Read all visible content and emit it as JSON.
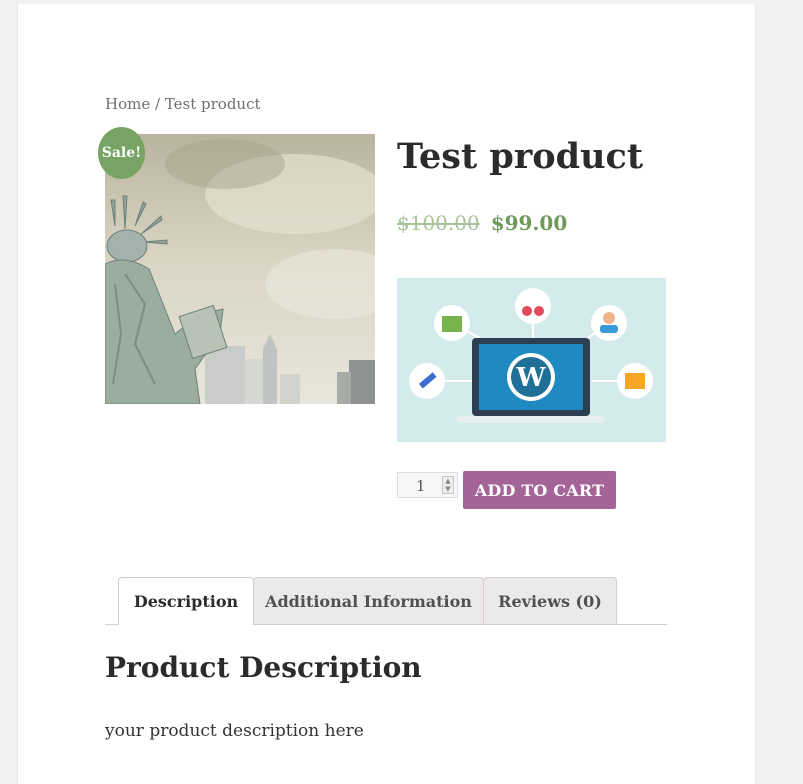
{
  "breadcrumb": {
    "home": "Home",
    "separator": " / ",
    "current": "Test product"
  },
  "product": {
    "sale_badge": "Sale!",
    "title": "Test product",
    "price_old": "$100.00",
    "price_new": "$99.00",
    "quantity": "1",
    "add_to_cart_label": "ADD TO CART",
    "main_image_icon": "statue-of-liberty-photo",
    "promo_image_icon": "wordpress-laptop-illustration"
  },
  "tabs": [
    {
      "label": "Description"
    },
    {
      "label": "Additional Information"
    },
    {
      "label": "Reviews (0)"
    }
  ],
  "description": {
    "heading": "Product Description",
    "text": "your product description here"
  },
  "colors": {
    "sale_badge": "#77a464",
    "price_new": "#6f9a5c",
    "add_to_cart": "#a46497"
  }
}
